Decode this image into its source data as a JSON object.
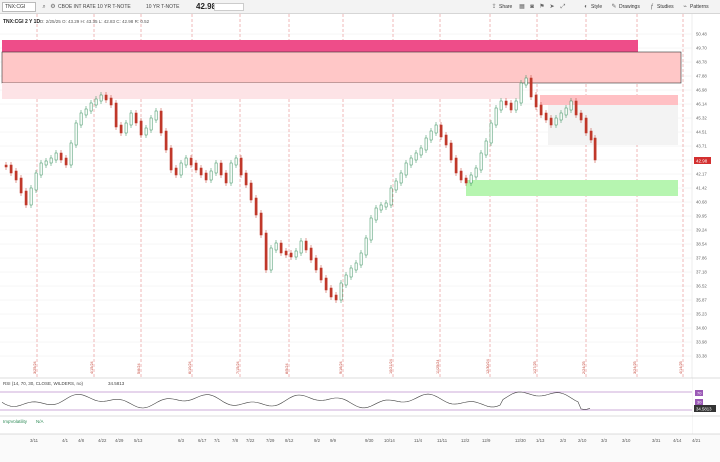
{
  "toolbar": {
    "symbol": "TNX:CGI",
    "description": "CBOE INT RATE 10 YR T-NOTE",
    "description2": "10 YR T-NOTE",
    "last": "42.98",
    "change_badge": "",
    "buttons": [
      "Share",
      "Style",
      "Drawings",
      "Studies",
      "Patterns"
    ]
  },
  "header": {
    "title": "TNX:CGI 2 Y 1D",
    "ohlc": "D: 2/25/25   O: 43.29   H: 43.35   L: 42.83   C: 42.98   R: 0.52"
  },
  "price_axis": {
    "labels": [
      "50.48",
      "49.70",
      "48.78",
      "47.88",
      "46.98",
      "46.14",
      "45.32",
      "44.51",
      "43.71",
      "42.98",
      "42.17",
      "41.42",
      "40.68",
      "39.95",
      "39.24",
      "38.54",
      "37.86",
      "37.18",
      "36.52",
      "35.87",
      "35.23",
      "34.60",
      "33.98",
      "33.38"
    ],
    "current": "42.98"
  },
  "rsi": {
    "label": "RSI (14, 70, 30, CLOSE, WILDERS, no)",
    "value": "34.5813",
    "upper": "70",
    "lower": "30"
  },
  "impvol": {
    "label": "ImpVolatility",
    "value": "N/A"
  },
  "x_axis": {
    "labels": [
      "3/11",
      "4/1",
      "4/8",
      "4/22",
      "4/29",
      "5/13",
      "6/3",
      "6/17",
      "7/1",
      "7/8",
      "7/22",
      "7/29",
      "8/12",
      "9/2",
      "9/9",
      "9/30",
      "10/14",
      "11/4",
      "11/11",
      "12/2",
      "12/9",
      "12/30",
      "1/13",
      "2/3",
      "2/10",
      "3/3",
      "3/10",
      "3/31",
      "4/14",
      "4/21"
    ]
  },
  "vertical_date_labels": [
    "3/25/24",
    "4/15/24",
    "5/6/24",
    "6/10/24",
    "7/15/24",
    "8/5/24",
    "9/16/24",
    "10/21/24",
    "11/25/24",
    "12/30/24",
    "1/27/25",
    "2/24/25",
    "3/24/25",
    "4/14/25"
  ],
  "colors": {
    "up": "#2e8b57",
    "down": "#c0392b",
    "zone_magenta": "#ee4d89",
    "zone_pink": "#ffc7c7",
    "zone_green": "#b6f5b0",
    "grid_red": "#e07070"
  }
}
